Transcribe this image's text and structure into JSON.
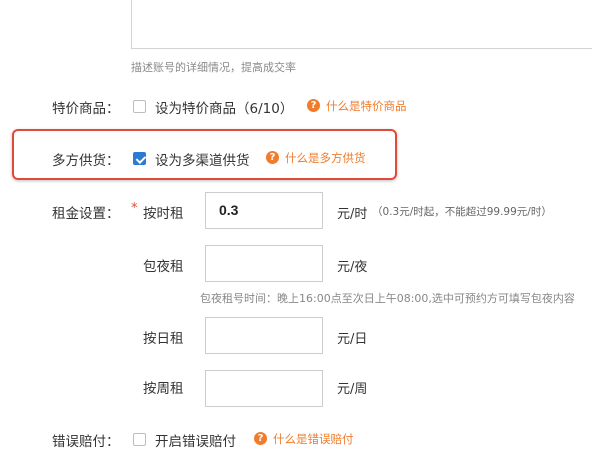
{
  "description": {
    "hint": "描述账号的详细情况，提高成交率"
  },
  "special": {
    "label": "特价商品：",
    "option": "设为特价商品（6/10）",
    "checked": false,
    "help": "什么是特价商品"
  },
  "multi_channel": {
    "label": "多方供货：",
    "option": "设为多渠道供货",
    "checked": true,
    "help": "什么是多方供货"
  },
  "rent": {
    "label": "租金设置：",
    "required_mark": "*",
    "hourly": {
      "label": "按时租",
      "value": "0.3",
      "unit": "元/时",
      "note": "（0.3元/时起，不能超过99.99元/时）"
    },
    "night": {
      "label": "包夜租",
      "value": "",
      "unit": "元/夜",
      "note": "包夜租号时间：晚上16:00点至次日上午08:00,选中可预约方可填写包夜内容"
    },
    "daily": {
      "label": "按日租",
      "value": "",
      "unit": "元/日"
    },
    "weekly": {
      "label": "按周租",
      "value": "",
      "unit": "元/周"
    }
  },
  "compensation": {
    "label": "错误赔付：",
    "option": "开启错误赔付",
    "checked": false,
    "help": "什么是错误赔付"
  },
  "icons": {
    "help": "question-circle-icon",
    "help_glyph": "?"
  },
  "colors": {
    "accent_orange": "#f07c2d",
    "highlight_red": "#e04a3a",
    "checkbox_blue": "#2b7ad6"
  }
}
